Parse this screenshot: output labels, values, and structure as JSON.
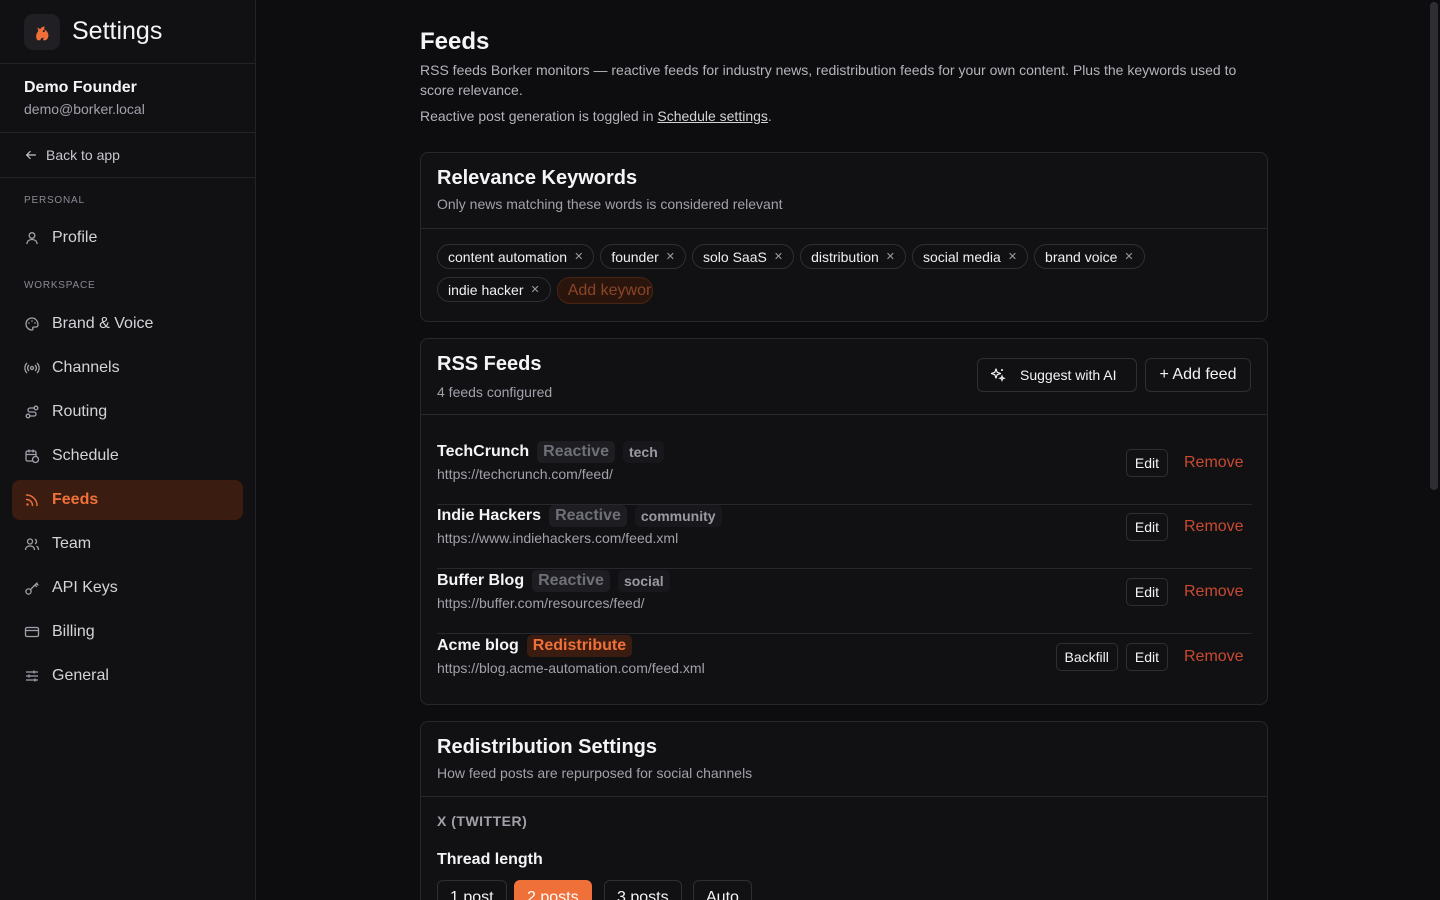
{
  "app": {
    "title": "Settings"
  },
  "user": {
    "name": "Demo Founder",
    "email": "demo@borker.local"
  },
  "back_label": "Back to app",
  "sidebar": {
    "personal_label": "PERSONAL",
    "workspace_label": "WORKSPACE",
    "items": [
      {
        "label": "Profile",
        "icon": "user-icon"
      },
      {
        "label": "Brand & Voice",
        "icon": "palette-icon"
      },
      {
        "label": "Channels",
        "icon": "broadcast-icon"
      },
      {
        "label": "Routing",
        "icon": "route-icon"
      },
      {
        "label": "Schedule",
        "icon": "calendar-clock-icon"
      },
      {
        "label": "Feeds",
        "icon": "rss-icon",
        "active": true
      },
      {
        "label": "Team",
        "icon": "users-icon"
      },
      {
        "label": "API Keys",
        "icon": "key-icon"
      },
      {
        "label": "Billing",
        "icon": "credit-card-icon"
      },
      {
        "label": "General",
        "icon": "sliders-icon"
      }
    ]
  },
  "page": {
    "title": "Feeds",
    "description": "RSS feeds Borker monitors — reactive feeds for industry news, redistribution feeds for your own content. Plus the keywords used to score relevance.",
    "note_prefix": "Reactive post generation is toggled in ",
    "note_link": "Schedule settings",
    "note_suffix": "."
  },
  "keywords_card": {
    "title": "Relevance Keywords",
    "subtitle": "Only news matching these words is considered relevant",
    "keywords": [
      "content automation",
      "founder",
      "solo SaaS",
      "distribution",
      "social media",
      "brand voice",
      "indie hacker"
    ],
    "add_placeholder": "Add keyword..."
  },
  "feeds_card": {
    "title": "RSS Feeds",
    "subtitle": "4 feeds configured",
    "suggest_label": "Suggest with AI",
    "add_label": "+ Add feed",
    "edit_label": "Edit",
    "remove_label": "Remove",
    "backfill_label": "Backfill",
    "feeds": [
      {
        "name": "TechCrunch",
        "type": "Reactive",
        "tag": "tech",
        "url": "https://techcrunch.com/feed/"
      },
      {
        "name": "Indie Hackers",
        "type": "Reactive",
        "tag": "community",
        "url": "https://www.indiehackers.com/feed.xml"
      },
      {
        "name": "Buffer Blog",
        "type": "Reactive",
        "tag": "social",
        "url": "https://buffer.com/resources/feed/"
      },
      {
        "name": "Acme blog",
        "type": "Redistribute",
        "tag": "",
        "url": "https://blog.acme-automation.com/feed.xml"
      }
    ]
  },
  "redistribution_card": {
    "title": "Redistribution Settings",
    "subtitle": "How feed posts are repurposed for social channels",
    "platform": "X (TWITTER)",
    "thread_label": "Thread length",
    "options": [
      "1 post",
      "2 posts",
      "3 posts",
      "Auto"
    ],
    "selected": "2 posts"
  },
  "colors": {
    "accent": "#f0703a",
    "remove": "#c84a30",
    "background": "#0d0d10"
  }
}
